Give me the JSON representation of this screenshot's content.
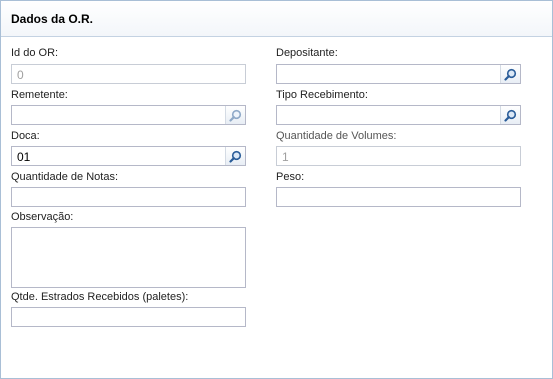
{
  "panel": {
    "title": "Dados da O.R."
  },
  "fields": {
    "id_or": {
      "label": "Id do OR:",
      "value": "0"
    },
    "depositante": {
      "label": "Depositante:",
      "value": ""
    },
    "remetente": {
      "label": "Remetente:",
      "value": ""
    },
    "tipo_recebimento": {
      "label": "Tipo Recebimento:",
      "value": ""
    },
    "doca": {
      "label": "Doca:",
      "value": "01"
    },
    "quantidade_volumes": {
      "label": "Quantidade de Volumes:",
      "value": "1"
    },
    "quantidade_notas": {
      "label": "Quantidade de Notas:",
      "value": ""
    },
    "peso": {
      "label": "Peso:",
      "value": ""
    },
    "observacao": {
      "label": "Observação:",
      "value": ""
    },
    "qtde_estrados": {
      "label": "Qtde. Estrados Recebidos (paletes):",
      "value": ""
    }
  },
  "icons": {
    "lookup": "search-icon"
  },
  "colors": {
    "icon_active": "#2a5d99",
    "icon_inactive": "#8fa9c8",
    "border": "#a9bfd6"
  }
}
